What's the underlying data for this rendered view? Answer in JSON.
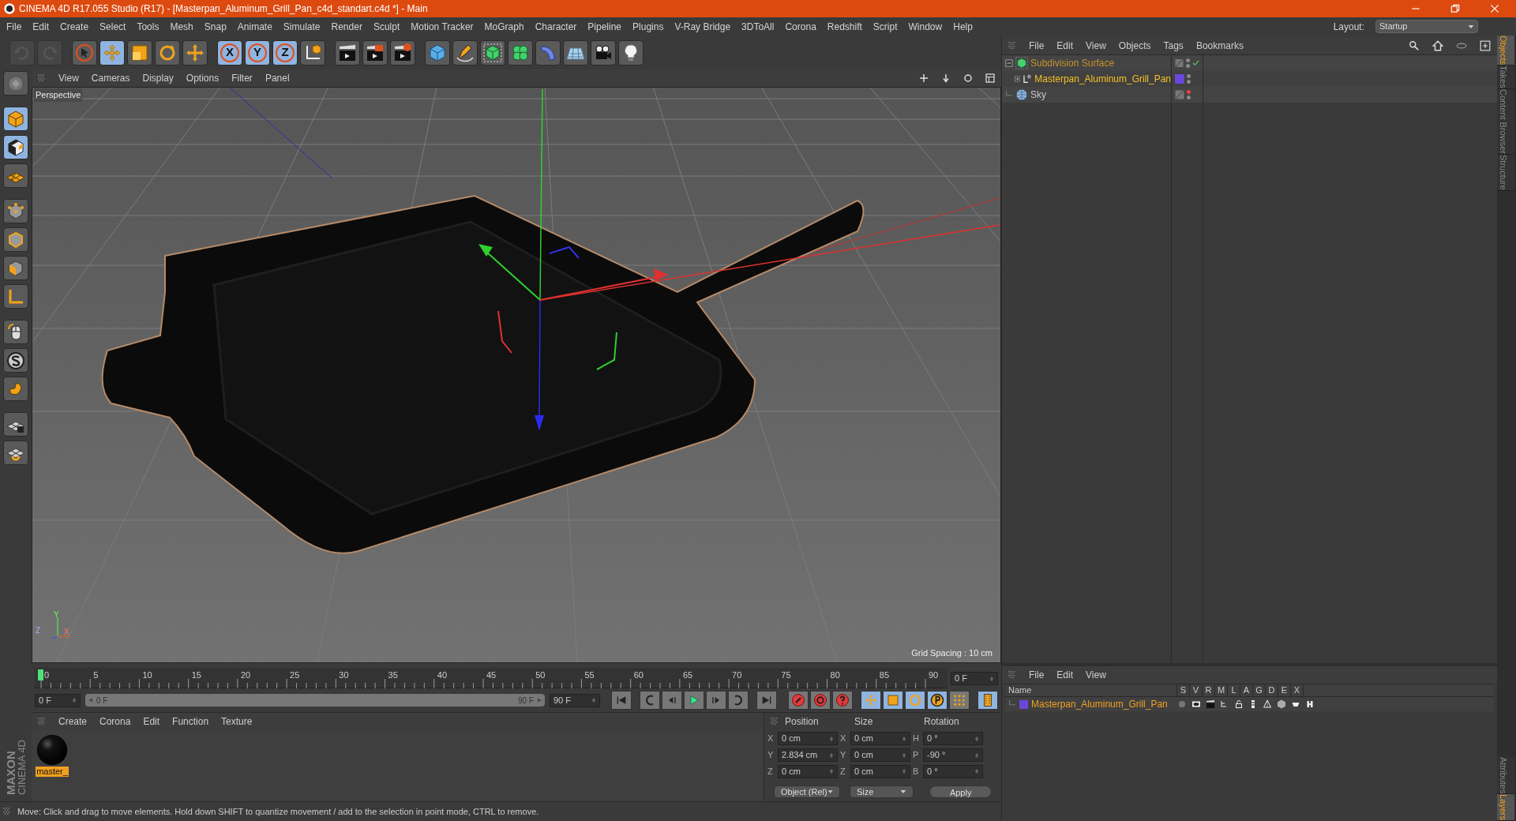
{
  "window": {
    "title": "CINEMA 4D R17.055 Studio (R17) - [Masterpan_Aluminum_Grill_Pan_c4d_standart.c4d *] - Main",
    "layout_label": "Layout:",
    "layout_value": "Startup"
  },
  "menu": [
    "File",
    "Edit",
    "Create",
    "Select",
    "Tools",
    "Mesh",
    "Snap",
    "Animate",
    "Simulate",
    "Render",
    "Sculpt",
    "Motion Tracker",
    "MoGraph",
    "Character",
    "Pipeline",
    "Plugins",
    "V-Ray Bridge",
    "3DToAll",
    "Corona",
    "Redshift",
    "Script",
    "Window",
    "Help"
  ],
  "toolbar": [
    {
      "kind": "undo",
      "selected": false,
      "disabled": true
    },
    {
      "kind": "redo",
      "selected": false,
      "disabled": true
    },
    {
      "kind": "select",
      "selected": false,
      "disabled": false
    },
    {
      "kind": "move",
      "selected": true,
      "disabled": false
    },
    {
      "kind": "scale",
      "selected": false,
      "disabled": false
    },
    {
      "kind": "rotate",
      "selected": false,
      "disabled": false
    },
    {
      "kind": "transform",
      "selected": false,
      "disabled": false
    },
    {
      "kind": "axis",
      "label": "X",
      "selected": true,
      "disabled": false
    },
    {
      "kind": "axis",
      "label": "Y",
      "selected": true,
      "disabled": false
    },
    {
      "kind": "axis",
      "label": "Z",
      "selected": true,
      "disabled": false
    },
    {
      "kind": "coords",
      "selected": false,
      "disabled": false
    },
    {
      "kind": "render_view",
      "selected": false,
      "disabled": false
    },
    {
      "kind": "render",
      "selected": false,
      "disabled": false
    },
    {
      "kind": "render_settings",
      "selected": false,
      "disabled": false
    },
    {
      "kind": "cube",
      "selected": false,
      "disabled": false
    },
    {
      "kind": "pen",
      "selected": false,
      "disabled": false
    },
    {
      "kind": "subdiv",
      "selected": false,
      "disabled": false
    },
    {
      "kind": "cloner",
      "selected": false,
      "disabled": false
    },
    {
      "kind": "deformer",
      "selected": false,
      "disabled": false
    },
    {
      "kind": "floor",
      "selected": false,
      "disabled": false
    },
    {
      "kind": "camera",
      "selected": false,
      "disabled": false
    },
    {
      "kind": "light",
      "selected": false,
      "disabled": false
    }
  ],
  "left_tools": [
    {
      "kind": "make_editable",
      "selected": false
    },
    {
      "kind": "model",
      "selected": true
    },
    {
      "kind": "texture",
      "selected": true
    },
    {
      "kind": "workplane",
      "selected": false
    },
    {
      "kind": "points",
      "selected": false
    },
    {
      "kind": "edges",
      "selected": false
    },
    {
      "kind": "polygons",
      "selected": false
    },
    {
      "kind": "axis_mode",
      "selected": false
    },
    {
      "kind": "tweak",
      "selected": false
    },
    {
      "kind": "soft",
      "selected": false
    },
    {
      "kind": "magnet",
      "selected": false
    },
    {
      "kind": "snap_lock",
      "selected": false
    },
    {
      "kind": "snap",
      "selected": false
    }
  ],
  "brand": [
    "MAXON",
    "CINEMA 4D"
  ],
  "viewport": {
    "menu": [
      "View",
      "Cameras",
      "Display",
      "Options",
      "Filter",
      "Panel"
    ],
    "camera": "Perspective",
    "grid_spacing": "Grid Spacing : 10 cm",
    "axis_labels": [
      "Y",
      "Z",
      "X"
    ]
  },
  "timeline": {
    "labels": [
      "0",
      "5",
      "10",
      "15",
      "20",
      "25",
      "30",
      "35",
      "40",
      "45",
      "50",
      "55",
      "60",
      "65",
      "70",
      "75",
      "80",
      "85",
      "90"
    ],
    "level": 0,
    "current_field": "0 F",
    "start_field": "0 F",
    "range_slider": {
      "start": "0 F",
      "end": "90 F",
      "level": 1
    },
    "end_field": "90 F"
  },
  "playback": [
    {
      "kind": "first"
    },
    {
      "kind": "prev_key"
    },
    {
      "kind": "prev"
    },
    {
      "kind": "play"
    },
    {
      "kind": "next"
    },
    {
      "kind": "next_key"
    },
    {
      "kind": "last"
    }
  ],
  "keyframe_tools": [
    {
      "kind": "record",
      "selected": false
    },
    {
      "kind": "autokey",
      "selected": false
    },
    {
      "kind": "keyset",
      "selected": false
    },
    {
      "kind": "key_pos",
      "selected": true
    },
    {
      "kind": "key_scale",
      "selected": true
    },
    {
      "kind": "key_rot",
      "selected": true
    },
    {
      "kind": "key_param",
      "selected": true
    },
    {
      "kind": "key_pla",
      "selected": false
    },
    {
      "kind": "timeline",
      "selected": true
    }
  ],
  "materials": {
    "menu": [
      "Create",
      "Corona",
      "Edit",
      "Function",
      "Texture"
    ],
    "items": [
      {
        "name": "master_",
        "selected": true
      }
    ]
  },
  "coordinates": {
    "headers": [
      "Position",
      "Size",
      "Rotation"
    ],
    "rows": [
      {
        "pos_label": "X",
        "pos": "0 cm",
        "size_label": "X",
        "size": "0 cm",
        "rot_label": "H",
        "rot": "0 °"
      },
      {
        "pos_label": "Y",
        "pos": "2.834 cm",
        "size_label": "Y",
        "size": "0 cm",
        "rot_label": "P",
        "rot": "-90 °"
      },
      {
        "pos_label": "Z",
        "pos": "0 cm",
        "size_label": "Z",
        "size": "0 cm",
        "rot_label": "B",
        "rot": "0 °"
      }
    ],
    "mode": "Object (Rel)",
    "size_mode": "Size",
    "apply": "Apply"
  },
  "status_bar": "Move: Click and drag to move elements. Hold down SHIFT to quantize movement / add to the selection in point mode, CTRL to remove.",
  "objects": {
    "menu": [
      "File",
      "Edit",
      "View",
      "Objects",
      "Tags",
      "Bookmarks"
    ],
    "tree": [
      {
        "name": "Subdivision Surface",
        "kind": "subdiv",
        "selected": false,
        "child_selected": true,
        "expanded": true,
        "editor_visible": true,
        "enabled": true,
        "children": [
          {
            "name": "Masterpan_Aluminum_Grill_Pan",
            "kind": "polygon",
            "selected": true,
            "expanded": false,
            "editor_visible": true,
            "enabled": false,
            "color": "#6b47dc"
          }
        ]
      },
      {
        "name": "Sky",
        "kind": "sky",
        "selected": false,
        "child_selected": false,
        "editor_visible": false,
        "enabled": false
      }
    ]
  },
  "layers": {
    "menu": [
      "File",
      "Edit",
      "View"
    ],
    "columns": [
      "Name",
      "S",
      "V",
      "R",
      "M",
      "L",
      "A",
      "G",
      "D",
      "E",
      "X"
    ],
    "rows": [
      {
        "name": "Masterpan_Aluminum_Grill_Pan",
        "color": "#6b47dc",
        "selected": true
      }
    ]
  },
  "side_tabs_top": [
    {
      "label": "Objects",
      "selected": true
    },
    {
      "label": "Takes",
      "selected": false
    },
    {
      "label": "Content Browser",
      "selected": false
    },
    {
      "label": "Structure",
      "selected": false
    }
  ],
  "side_tabs_bottom": [
    {
      "label": "Attributes",
      "selected": false
    },
    {
      "label": "Layers",
      "selected": true
    }
  ]
}
